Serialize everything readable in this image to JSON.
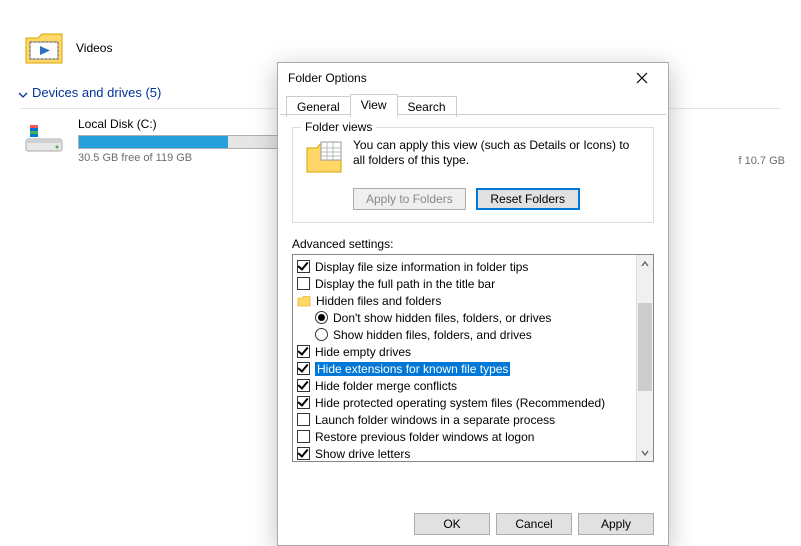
{
  "explorer": {
    "videos_label": "Videos",
    "section_label": "Devices and drives (5)",
    "drive_name": "Local Disk (C:)",
    "drive_free": "30.5 GB free of 119 GB",
    "drive_fill_pct": 75,
    "right_snip": "f 10.7 GB"
  },
  "dialog": {
    "title": "Folder Options",
    "tabs": {
      "general": "General",
      "view": "View",
      "search": "Search"
    },
    "folder_views": {
      "legend": "Folder views",
      "text": "You can apply this view (such as Details or Icons) to all folders of this type.",
      "apply": "Apply to Folders",
      "reset": "Reset Folders"
    },
    "advanced_label": "Advanced settings:",
    "items": [
      {
        "kind": "check",
        "checked": true,
        "label": "Display file size information in folder tips"
      },
      {
        "kind": "check",
        "checked": false,
        "label": "Display the full path in the title bar"
      },
      {
        "kind": "folder",
        "label": "Hidden files and folders"
      },
      {
        "kind": "radio",
        "checked": true,
        "indent": true,
        "label": "Don't show hidden files, folders, or drives"
      },
      {
        "kind": "radio",
        "checked": false,
        "indent": true,
        "label": "Show hidden files, folders, and drives"
      },
      {
        "kind": "check",
        "checked": true,
        "label": "Hide empty drives"
      },
      {
        "kind": "check",
        "checked": true,
        "selected": true,
        "label": "Hide extensions for known file types"
      },
      {
        "kind": "check",
        "checked": true,
        "label": "Hide folder merge conflicts"
      },
      {
        "kind": "check",
        "checked": true,
        "label": "Hide protected operating system files (Recommended)"
      },
      {
        "kind": "check",
        "checked": false,
        "label": "Launch folder windows in a separate process"
      },
      {
        "kind": "check",
        "checked": false,
        "label": "Restore previous folder windows at logon"
      },
      {
        "kind": "check",
        "checked": true,
        "label": "Show drive letters"
      }
    ],
    "buttons": {
      "ok": "OK",
      "cancel": "Cancel",
      "apply": "Apply"
    }
  }
}
